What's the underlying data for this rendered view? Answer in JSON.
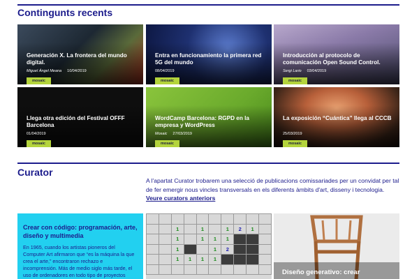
{
  "recent": {
    "title": "Contingunts recents",
    "cards": [
      {
        "title": "Generación X. La frontera del mundo digital.",
        "author": "Miguel Ángel Meana",
        "date": "10/04/2019",
        "tag": "mosaic",
        "color": "#2c3e50"
      },
      {
        "title": "Entra en funcionamiento la primera red 5G del mundo",
        "author": "",
        "date": "08/04/2019",
        "tag": "mosaic",
        "color": "#1e3070"
      },
      {
        "title": "Introducción al protocolo de comunicación Open Sound Control.",
        "author": "Sergi Lario",
        "date": "03/04/2019",
        "tag": "mosaic",
        "color": "#6a6a8a"
      },
      {
        "title": "Llega otra edición del Festival OFFF Barcelona",
        "author": "",
        "date": "01/04/2019",
        "tag": "mosaic",
        "color": "#111111"
      },
      {
        "title": "WordCamp Barcelona: RGPD en la empresa y WordPress",
        "author": "Mosaic",
        "date": "27/03/2019",
        "tag": "mosaic",
        "color": "#6aaa2c"
      },
      {
        "title": "La exposición “Cuántica” llega al CCCB",
        "author": "",
        "date": "25/03/2019",
        "tag": "mosaic",
        "color": "#3a2418"
      }
    ]
  },
  "curator": {
    "title": "Curator",
    "intro": "A l'apartat Curator trobarem una selecció de publicacions comissariades per un convidat per tal de fer emergir nous vincles transversals en els diferents àmbits d'art, disseny i tecnologia.",
    "link": "Veure curators anteriors",
    "tile1": {
      "title": "Crear con código: programación, arte, diseño y multimedia",
      "body": "En 1965, cuando los artistas pioneros del Computer Art afirmaron que “es la máquina la que crea el arte,” encontraron rechazo e incomprensión. Más de medio siglo más tarde, el uso de ordenadores en todo tipo de proyectos"
    },
    "grid": [
      [
        "",
        "",
        "",
        "",
        "",
        "",
        "",
        "",
        "",
        ""
      ],
      [
        "",
        "",
        "1",
        "",
        "1",
        "",
        "1",
        "2",
        "1",
        ""
      ],
      [
        "",
        "",
        "1",
        "",
        "1",
        "1",
        "1",
        "D",
        "D",
        ""
      ],
      [
        "",
        "",
        "1",
        "D",
        "",
        "1",
        "2",
        "D",
        "D",
        ""
      ],
      [
        "",
        "",
        "1",
        "1",
        "1",
        "1",
        "D",
        "D",
        "D",
        ""
      ],
      [
        "",
        "",
        "",
        "",
        "",
        "",
        "",
        "",
        "",
        ""
      ]
    ],
    "tile3": {
      "title": "Diseño generativo: crear"
    }
  }
}
